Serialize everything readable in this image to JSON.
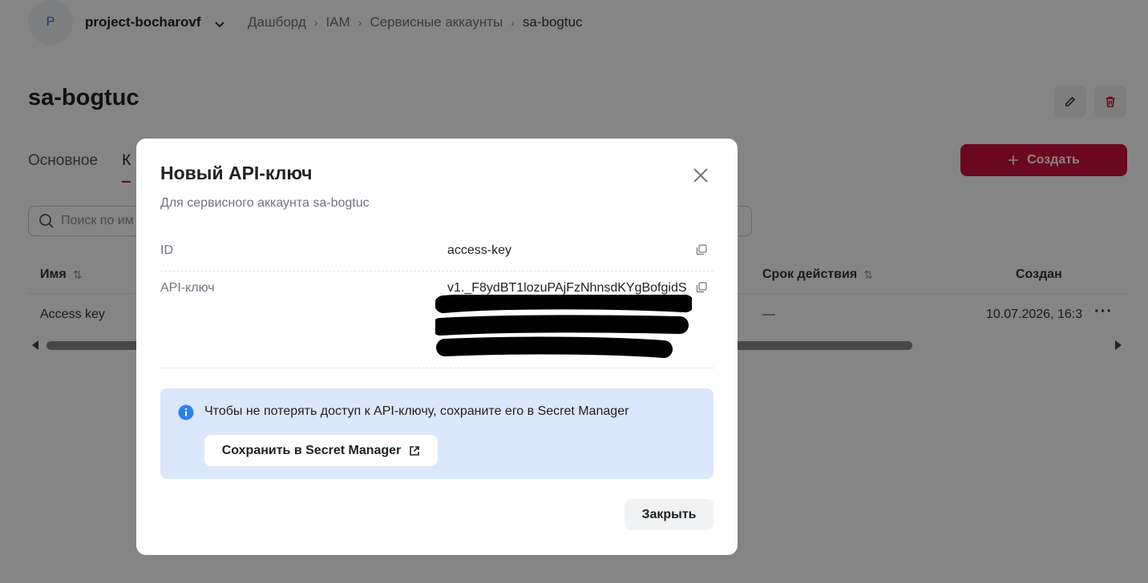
{
  "header": {
    "avatar_letter": "P",
    "project_name": "project-bocharovf",
    "breadcrumbs": [
      "Дашборд",
      "IAM",
      "Сервисные аккаунты",
      "sa-bogtuc"
    ]
  },
  "page": {
    "title": "sa-bogtuc",
    "tabs": [
      {
        "label": "Основное"
      },
      {
        "label": "К"
      }
    ],
    "create_label": "Создать",
    "search_placeholder": "Поиск по им"
  },
  "table": {
    "columns": [
      "Имя",
      "Срок действия",
      "Создан"
    ],
    "rows": [
      {
        "name": "Access key",
        "expiry": "—",
        "created": "10.07.2026, 16:3"
      }
    ]
  },
  "modal": {
    "title": "Новый API-ключ",
    "subtitle": "Для сервисного аккаунта sa-bogtuc",
    "id_label": "ID",
    "id_value": "access-key",
    "key_label": "API-ключ",
    "key_value": "v1._F8ydBT1lozuPAjFzNhnsdKYgBofgidS",
    "info_text": "Чтобы не потерять доступ к API-ключу, сохраните его в Secret Manager",
    "save_button": "Сохранить в Secret Manager",
    "close_button": "Закрыть"
  },
  "colors": {
    "accent": "#d0103a",
    "info_bg": "#dbe7fb",
    "info_icon": "#2f80ed",
    "overlay": "rgba(0,0,0,0.48)"
  },
  "icons": [
    "chevron-down-icon",
    "chevron-right-icon",
    "pencil-icon",
    "trash-icon",
    "plus-icon",
    "search-icon",
    "sort-icon",
    "more-icon",
    "close-icon",
    "copy-icon",
    "info-icon",
    "external-link-icon"
  ]
}
